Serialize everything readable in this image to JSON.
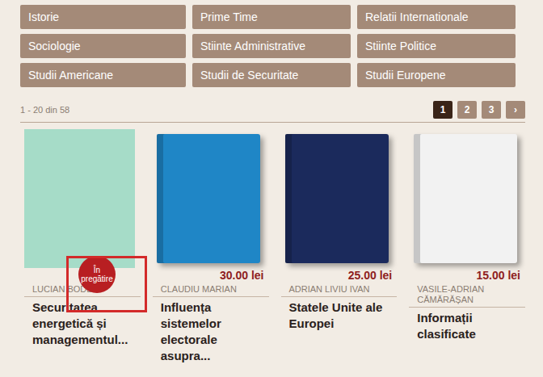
{
  "categories": [
    "Istorie",
    "Prime Time",
    "Relatii Internationale",
    "Sociologie",
    "Stiinte Administrative",
    "Stiinte Politice",
    "Studii Americane",
    "Studii de Securitate",
    "Studii Europene"
  ],
  "results": {
    "count": "1 - 20 din 58"
  },
  "pagination": [
    {
      "label": "1",
      "selected": true
    },
    {
      "label": "2",
      "selected": false
    },
    {
      "label": "3",
      "selected": false
    },
    {
      "label": "›",
      "selected": false
    }
  ],
  "products": [
    {
      "kind": "flat",
      "color": "#a6dcc8",
      "price": "",
      "badge": "În pregătire",
      "highlighted": true,
      "author": "LUCIAN BODE",
      "title": "Securitatea energetică și managementul..."
    },
    {
      "kind": "book",
      "color": "#1f86c6",
      "price": "30.00 lei",
      "badge": "",
      "highlighted": false,
      "author": "CLAUDIU MARIAN",
      "title": "Influența sistemelor electorale asupra..."
    },
    {
      "kind": "book",
      "color": "#1b2a5c",
      "price": "25.00 lei",
      "badge": "",
      "highlighted": false,
      "author": "ADRIAN LIVIU IVAN",
      "title": "Statele Unite ale Europei"
    },
    {
      "kind": "book",
      "color": "#f2f2f2",
      "price": "15.00 lei",
      "badge": "",
      "highlighted": false,
      "author": "VASILE-ADRIAN CĂMĂRĂȘAN",
      "title": "Informații clasificate"
    }
  ]
}
